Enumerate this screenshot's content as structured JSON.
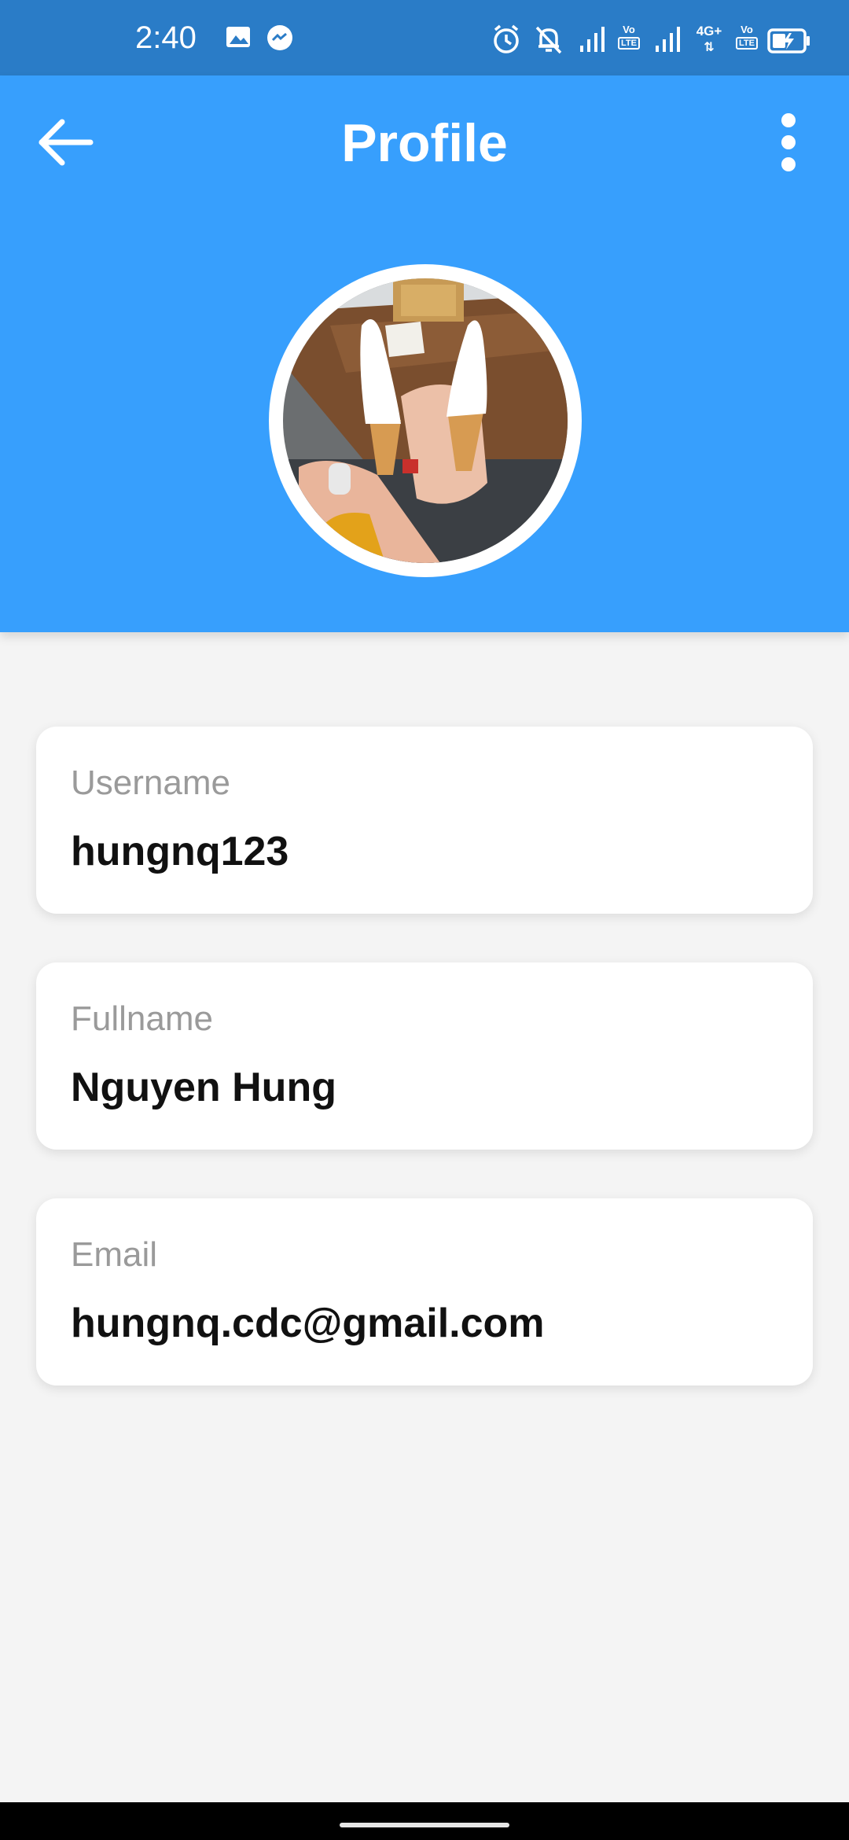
{
  "status_bar": {
    "time": "2:40",
    "icons": [
      "image-icon",
      "messenger-icon",
      "alarm-icon",
      "bell-off-icon",
      "signal-icon",
      "volte-icon",
      "signal-icon",
      "4g-icon",
      "volte-icon",
      "battery-charging-icon"
    ],
    "volte_label": "Vo",
    "lte_label": "LTE",
    "network_label": "4G+"
  },
  "app_bar": {
    "title": "Profile",
    "back_icon": "arrow-left-icon",
    "menu_icon": "more-vert-icon",
    "background_color": "#379ffd"
  },
  "avatar": {
    "description": "profile-photo"
  },
  "fields": [
    {
      "label": "Username",
      "value": "hungnq123"
    },
    {
      "label": "Fullname",
      "value": "Nguyen Hung"
    },
    {
      "label": "Email",
      "value": "hungnq.cdc@gmail.com"
    }
  ]
}
